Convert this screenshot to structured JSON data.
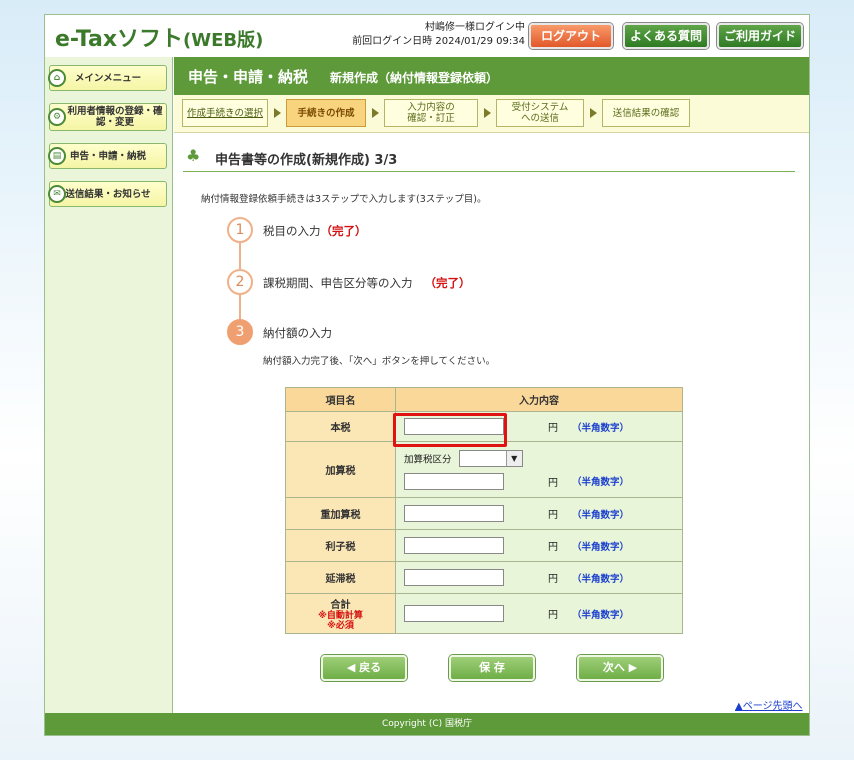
{
  "header": {
    "logo_main": "e-Taxソフト",
    "logo_paren": "(WEB版)",
    "user_line": "村嶋修一様ログイン中",
    "last_login": "前回ログイン日時 2024/01/29 09:34",
    "logout": "ログアウト",
    "faq": "よくある質問",
    "guide": "ご利用ガイド"
  },
  "sidebar": {
    "items": [
      {
        "label": "メインメニュー",
        "icon": "home-icon"
      },
      {
        "label": "利用者情報の登録・確認・変更",
        "icon": "user-settings-icon"
      },
      {
        "label": "申告・申請・納税",
        "icon": "document-icon"
      },
      {
        "label": "送信結果・お知らせ",
        "icon": "mail-icon"
      }
    ]
  },
  "titlebar": {
    "title": "申告・申請・納税",
    "subtitle": "新規作成（納付情報登録依頼）"
  },
  "steps": [
    {
      "label": "作成手続きの選択"
    },
    {
      "label": "手続きの作成"
    },
    {
      "label": "入力内容の確認・訂正"
    },
    {
      "label": "受付システムへの送信"
    },
    {
      "label": "送信結果の確認"
    }
  ],
  "section": {
    "title": "申告書等の作成(新規作成) 3/3",
    "intro": "納付情報登録依頼手続きは3ステップで入力します(3ステップ目)。"
  },
  "progress": {
    "s1": {
      "num": "1",
      "label": "税目の入力",
      "status": "（完了）"
    },
    "s2": {
      "num": "2",
      "label": "課税期間、申告区分等の入力",
      "status": "（完了）"
    },
    "s3": {
      "num": "3",
      "label": "納付額の入力"
    },
    "note": "納付額入力完了後、「次へ」ボタンを押してください。"
  },
  "table": {
    "col_name": "項目名",
    "col_input": "入力内容",
    "yen": "円",
    "hint": "（半角数字）",
    "row_honzei": "本税",
    "row_kasanzei": "加算税",
    "kasanzei_kubun_label": "加算税区分",
    "row_jukasanzei": "重加算税",
    "row_rishizei": "利子税",
    "row_entaizei": "延滞税",
    "row_total": "合計",
    "total_note1": "※自動計算",
    "total_note2": "※必須"
  },
  "buttons": {
    "back": "◀ 戻る",
    "save": "保 存",
    "next": "次へ ▶"
  },
  "page_top": "ページ先頭へ",
  "footer": "Copyright (C) 国税庁",
  "colors": {
    "brand_green": "#5e9a3a",
    "highlight_red": "#e01212",
    "done_red": "#d41010"
  }
}
